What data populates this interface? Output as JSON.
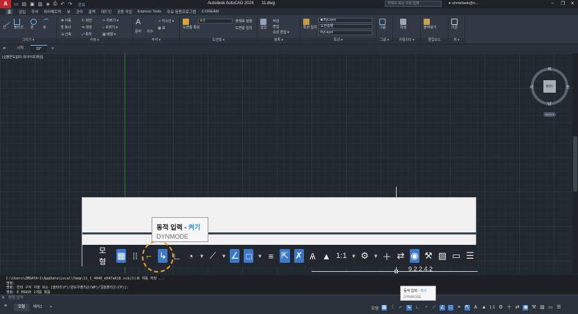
{
  "app": {
    "logo": "A",
    "title": "Autodesk AutoCAD 2024",
    "file": "11.dwg",
    "share": "공유",
    "search_placeholder": "키워드 또는 구문 입력",
    "user": "uhmkitaek@n...",
    "window_controls": [
      "–",
      "❐",
      "✕"
    ]
  },
  "ribbon_tabs": [
    "홈",
    "삽입",
    "주석",
    "파라메트릭",
    "뷰",
    "관리",
    "출력",
    "애드인",
    "공동 작업",
    "Express Tools",
    "주요 응용프로그램",
    "Z-DREAM"
  ],
  "ribbon": {
    "groups": [
      {
        "label": "그리기 ▾",
        "tools": [
          "선",
          "폴리선",
          "원",
          "호"
        ]
      },
      {
        "label": "수정 ▾",
        "tools": [
          "이동",
          "회전",
          "자르기 ▾",
          "복사",
          "대칭",
          "모깎기 ▾",
          "신축",
          "축척",
          "배열 ▾"
        ]
      },
      {
        "label": "주석 ▾",
        "tools": [
          "문자",
          "치수",
          "지시선 ▾",
          "표"
        ]
      },
      {
        "label": "도면층 ▾",
        "tools": [
          "도면층 특성",
          "현재로 설정",
          "도면층 일치"
        ]
      },
      {
        "label": "블록 ▾",
        "tools": [
          "삽입",
          "작성",
          "편집",
          "속성 편집 ▾"
        ]
      },
      {
        "label": "특성 ▾",
        "tools": [
          "특성 일치",
          "ByLayer",
          "도면층별",
          "ByLayer"
        ]
      },
      {
        "label": "그룹 ▾",
        "tools": [
          "그룹"
        ]
      },
      {
        "label": "유틸리티 ▾",
        "tools": [
          "측정"
        ]
      },
      {
        "label": "클립보드",
        "tools": [
          "붙여넣기"
        ]
      },
      {
        "label": "뷰 ▾",
        "tools": [
          "기준"
        ]
      }
    ],
    "layer_value": "0"
  },
  "file_tabs": [
    "시작",
    "11*"
  ],
  "drawing": {
    "viewport_label": "[-][평면도][2D 와이어프레임]",
    "viewcube": {
      "top": "북",
      "bottom": "남",
      "left": "서",
      "right": "동",
      "face": "평면도",
      "wcs": "WCS ▾"
    }
  },
  "zoomed_status": {
    "model_label": "모형",
    "scale": "1:1",
    "partial_text": "9.2.2.4.2"
  },
  "tooltip": {
    "title": "동적 입력",
    "separator": " - ",
    "state": "켜기",
    "command": "DYNMODE"
  },
  "command_history": [
    "C:\\Users\\ZMDATA~1\\AppData\\Local\\Temp\\11_1_4940_e647a618.sv$(으)로 자동 저장 ...",
    "명령:",
    "명령: 반대 구석 지정 또는 [울타리(F)/윈도우폴리곤(WP)/걸침폴리곤(CP)]:",
    "명령: E ERASE 1개를 찾음"
  ],
  "command_input_placeholder": "명령 입력",
  "layout_tabs": [
    "모형",
    "배치1",
    "+"
  ],
  "status_bar": {
    "model": "모형",
    "scale": "1:1"
  }
}
